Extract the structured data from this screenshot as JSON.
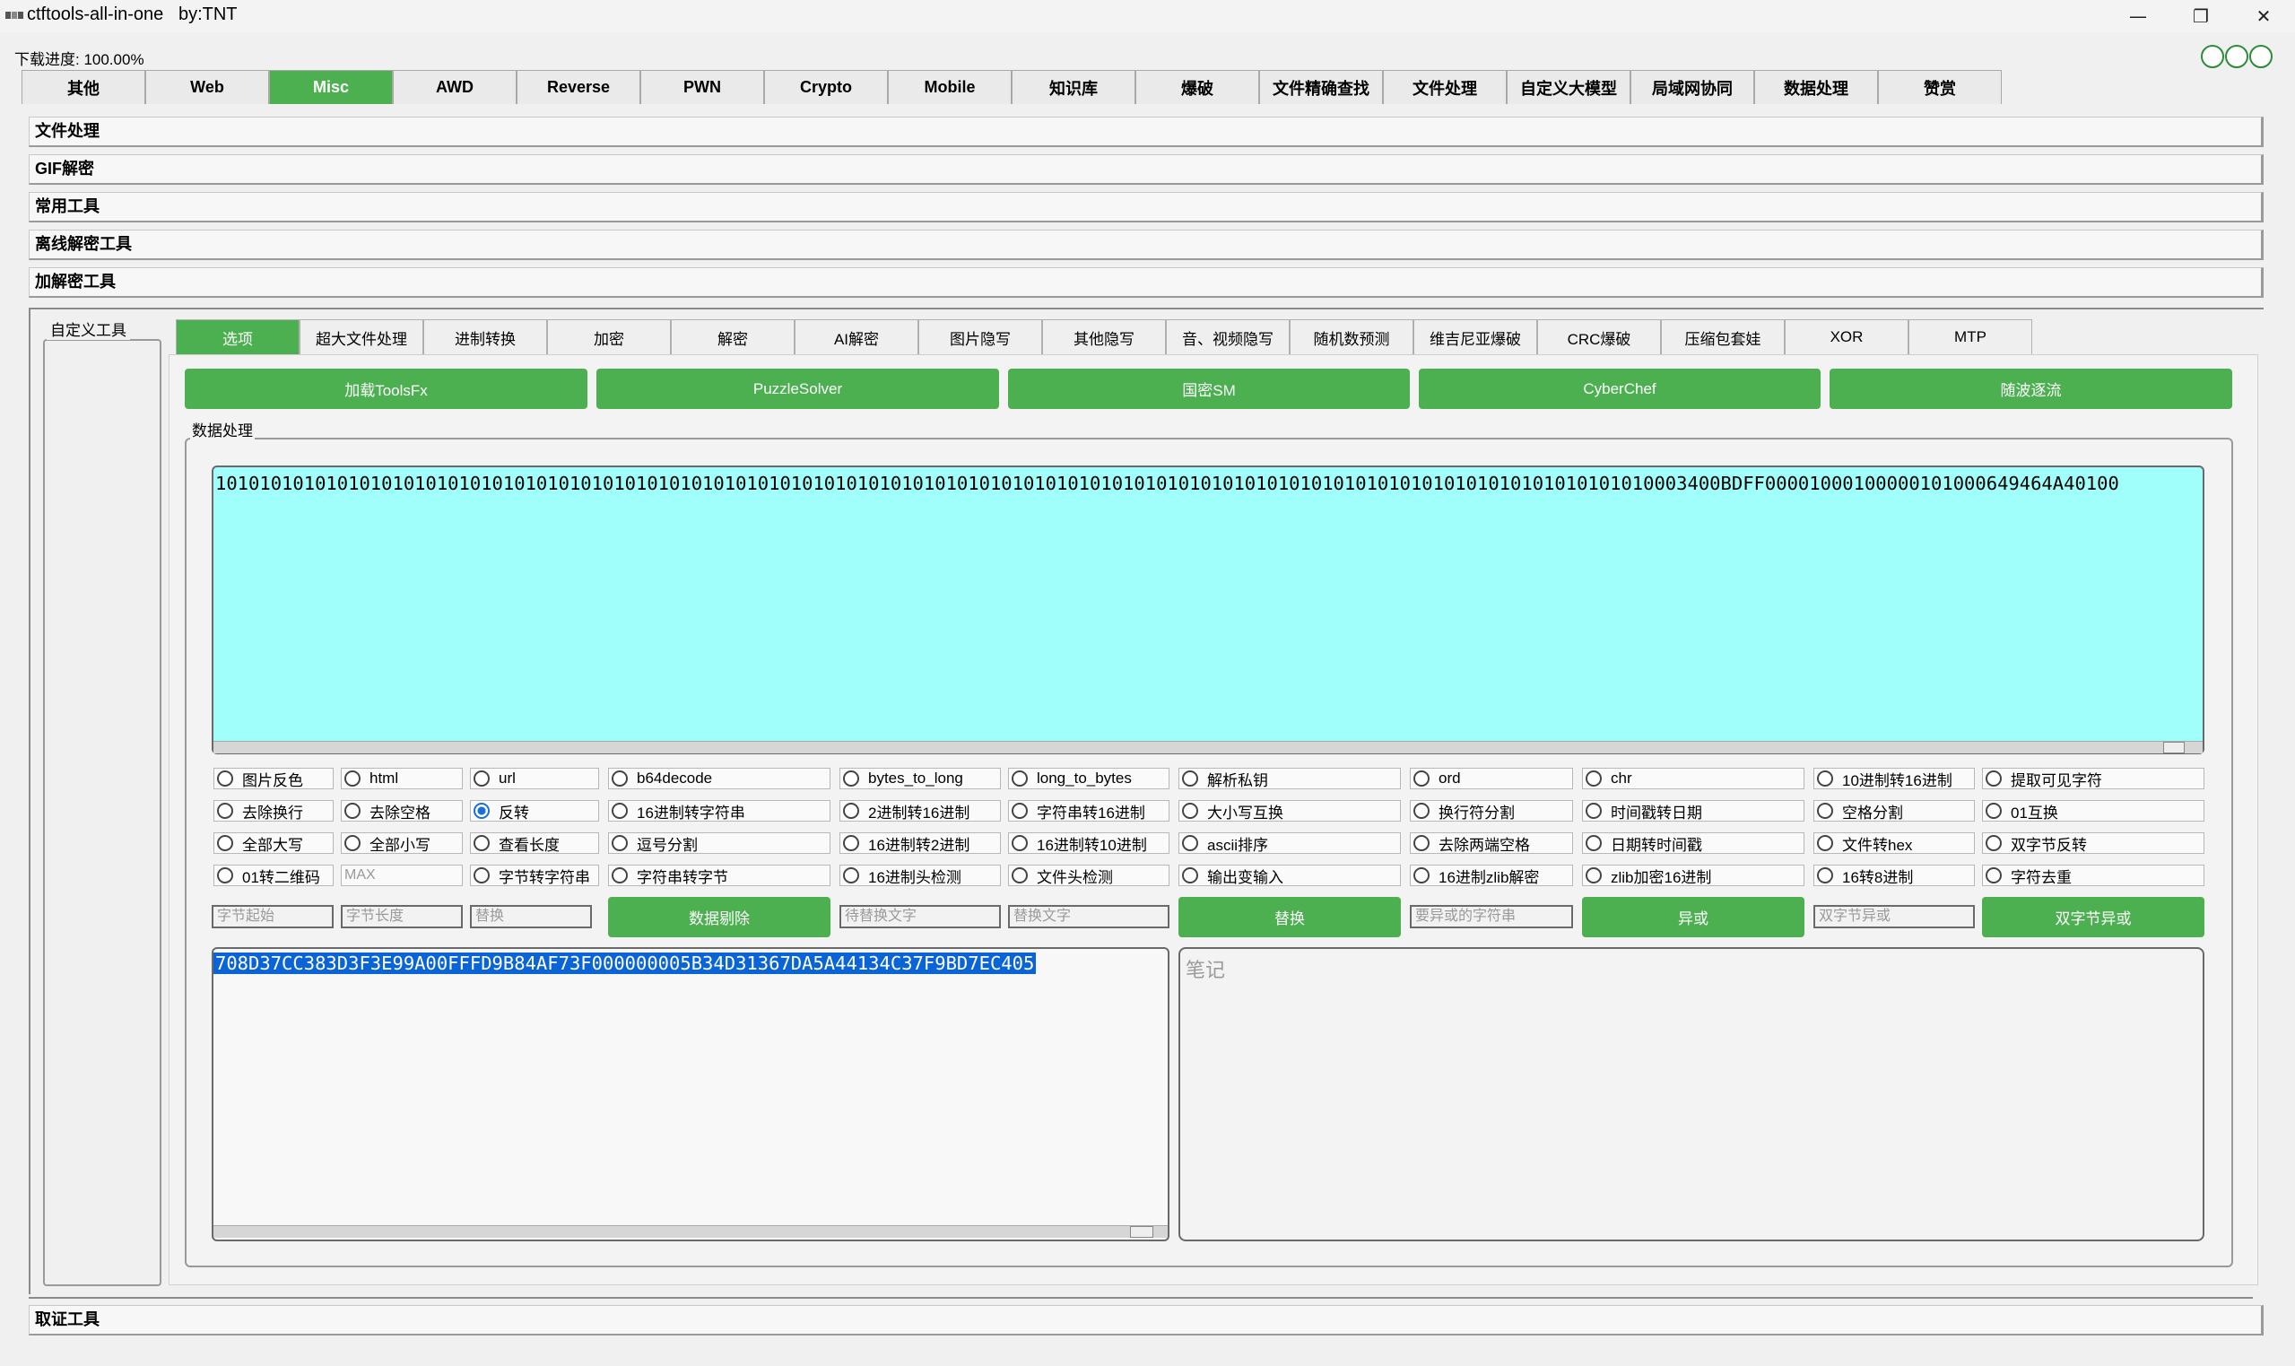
{
  "window": {
    "title": "ctftools-all-in-one   by:TNT",
    "minimize": "—",
    "restore": "❐",
    "close": "✕"
  },
  "progress": {
    "label": "下载进度: 100.00%",
    "value": 1.0
  },
  "top_tabs": [
    "其他",
    "Web",
    "Misc",
    "AWD",
    "Reverse",
    "PWN",
    "Crypto",
    "Mobile",
    "知识库",
    "爆破",
    "文件精确查找",
    "文件处理",
    "自定义大模型",
    "局域网协同",
    "数据处理",
    "赞赏"
  ],
  "top_tabs_active": "Misc",
  "sections": [
    "文件处理",
    "GIF解密",
    "常用工具",
    "离线解密工具",
    "加解密工具"
  ],
  "custom_tools_label": "自定义工具",
  "inner_tabs": [
    "选项",
    "超大文件处理",
    "进制转换",
    "加密",
    "解密",
    "AI解密",
    "图片隐写",
    "其他隐写",
    "音、视频隐写",
    "随机数预测",
    "维吉尼亚爆破",
    "CRC爆破",
    "压缩包套娃",
    "XOR",
    "MTP"
  ],
  "inner_tabs_active": "选项",
  "tool_buttons": [
    "加载ToolsFx",
    "PuzzleSolver",
    "国密SM",
    "CyberChef",
    "随波逐流"
  ],
  "data_group_label": "数据处理",
  "input_text": "1010101010101010101010101010101010101010101010101010101010101010101010101010101010101010101010101010101010101010101010101010101010003400BDFF00001000100000101000649464A40100",
  "options": [
    [
      "图片反色",
      "html",
      "url",
      "b64decode",
      "bytes_to_long",
      "long_to_bytes",
      "解析私钥",
      "ord",
      "chr",
      "10进制转16进制",
      "提取可见字符"
    ],
    [
      "去除换行",
      "去除空格",
      "反转",
      "16进制转字符串",
      "2进制转16进制",
      "字符串转16进制",
      "大小写互换",
      "换行符分割",
      "时间戳转日期",
      "空格分割",
      "01互换"
    ],
    [
      "全部大写",
      "全部小写",
      "查看长度",
      "逗号分割",
      "16进制转2进制",
      "16进制转10进制",
      "ascii排序",
      "去除两端空格",
      "日期转时间戳",
      "文件转hex",
      "双字节反转"
    ],
    [
      "01转二维码",
      "",
      "字节转字符串",
      "字符串转字节",
      "16进制头检测",
      "文件头检测",
      "输出变输入",
      "16进制zlib解密",
      "zlib加密16进制",
      "16转8进制",
      "字符去重"
    ]
  ],
  "selected_option": "反转",
  "max_placeholder": "MAX",
  "action_row": {
    "byte_start_ph": "字节起始",
    "byte_len_ph": "字节长度",
    "replace_ph": "替换",
    "delete_btn": "数据剔除",
    "to_replace_ph": "待替换文字",
    "replace_text_ph": "替换文字",
    "replace_btn": "替换",
    "xor_str_ph": "要异或的字符串",
    "xor_btn": "异或",
    "dbyte_xor_ph": "双字节异或",
    "dbyte_xor_btn": "双字节异或"
  },
  "output_text": "708D37CC383D3F3E99A00FFFD9B84AF73F000000005B34D31367DA5A44134C37F9BD7EC405",
  "notes_placeholder": "笔记",
  "bottom_section": "取证工具",
  "colors": {
    "accent": "#4caf50",
    "input_bg": "#a0fffa",
    "selection": "#0a64d6"
  }
}
